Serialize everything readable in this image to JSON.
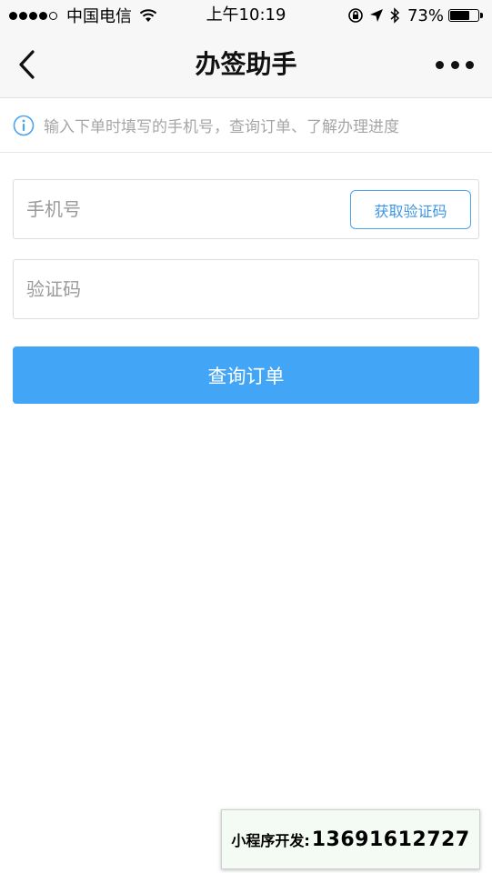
{
  "status_bar": {
    "carrier": "中国电信",
    "time": "上午10:19",
    "battery_percent_text": "73%",
    "battery_level": 0.73,
    "signal_bars": 4,
    "signal_total": 5
  },
  "nav": {
    "title": "办签助手",
    "back_icon": "chevron-left-icon",
    "more_icon": "more-dots-icon"
  },
  "info": {
    "icon": "info-circle-icon",
    "text": "输入下单时填写的手机号，查询订单、了解办理进度"
  },
  "form": {
    "phone_placeholder": "手机号",
    "phone_value": "",
    "code_placeholder": "验证码",
    "code_value": "",
    "get_code_label": "获取验证码",
    "submit_label": "查询订单"
  },
  "promo": {
    "label": "小程序开发:",
    "number": "13691612727"
  },
  "colors": {
    "primary": "#42a5f5",
    "accent_border": "#4aa3ee",
    "hint_text": "#a6a6a6",
    "nav_bg": "#f7f7f7"
  }
}
